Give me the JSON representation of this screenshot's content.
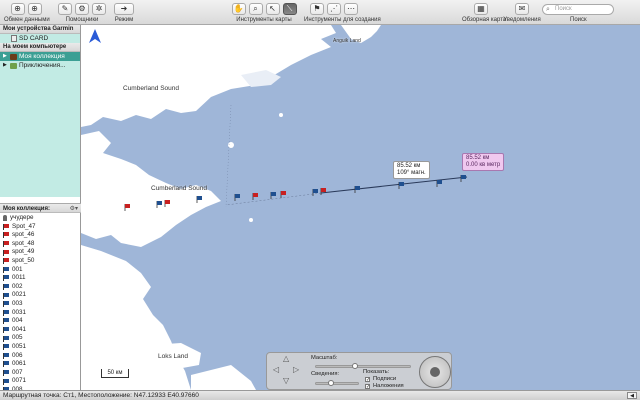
{
  "toolbar": {
    "exchange_label": "Обмен данными",
    "helpers_label": "Помощники",
    "mode_label": "Режим",
    "map_tools_label": "Инструменты карты",
    "create_tools_label": "Инструменты для создания",
    "overview_label": "Обзорная карта",
    "notifications_label": "Уведомления",
    "search_label": "Поиск",
    "search_placeholder": "Поиск"
  },
  "sidebar": {
    "devices_header": "Мои устройства Garmin",
    "sd_card": "SD CARD",
    "computer_header": "На моем компьютере",
    "my_collection": "Моя коллекция",
    "adventures": "Приключения...",
    "collection_header": "Моя коллекция:",
    "items": [
      {
        "label": "учудере",
        "icon": "pin"
      },
      {
        "label": "Spot_47",
        "icon": "red-flag"
      },
      {
        "label": "spot_46",
        "icon": "red-flag"
      },
      {
        "label": "spot_48",
        "icon": "red-flag"
      },
      {
        "label": "spot_49",
        "icon": "red-flag"
      },
      {
        "label": "spot_50",
        "icon": "red-flag"
      },
      {
        "label": "001",
        "icon": "blue-flag"
      },
      {
        "label": "0011",
        "icon": "blue-flag"
      },
      {
        "label": "002",
        "icon": "blue-flag"
      },
      {
        "label": "0021",
        "icon": "blue-flag"
      },
      {
        "label": "003",
        "icon": "blue-flag"
      },
      {
        "label": "0031",
        "icon": "blue-flag"
      },
      {
        "label": "004",
        "icon": "blue-flag"
      },
      {
        "label": "0041",
        "icon": "blue-flag"
      },
      {
        "label": "005",
        "icon": "blue-flag"
      },
      {
        "label": "0051",
        "icon": "blue-flag"
      },
      {
        "label": "006",
        "icon": "blue-flag"
      },
      {
        "label": "0061",
        "icon": "blue-flag"
      },
      {
        "label": "007",
        "icon": "blue-flag"
      },
      {
        "label": "0071",
        "icon": "blue-flag"
      },
      {
        "label": "008",
        "icon": "blue-flag"
      }
    ]
  },
  "map": {
    "labels": {
      "cumberland_sound_1": "Cumberland Sound",
      "cumberland_sound_2": "Cumberland Sound",
      "loks_land": "Loks Land",
      "angmak": "Anguik Land"
    },
    "callout_1": {
      "line1": "85.52 км",
      "line2": "109° магн."
    },
    "callout_2": {
      "line1": "85.52 км",
      "line2": "0.00 кв метр"
    },
    "scale_label": "50 км"
  },
  "controls": {
    "scale_label": "Масштаб:",
    "detail_label": "Сведения:",
    "show_label": "Показать:",
    "labels_cb": "Подписи",
    "overlay_cb": "Наложения"
  },
  "status": {
    "text": "Маршрутная точка: Ст1, Местоположение: N47.12933 E40.97660"
  },
  "colors": {
    "water": "#9fb6d8",
    "land": "#ffffff",
    "sidebar_mint": "#c2ebe4",
    "selection": "#3b9f94",
    "route_line": "#2a3a5a"
  }
}
